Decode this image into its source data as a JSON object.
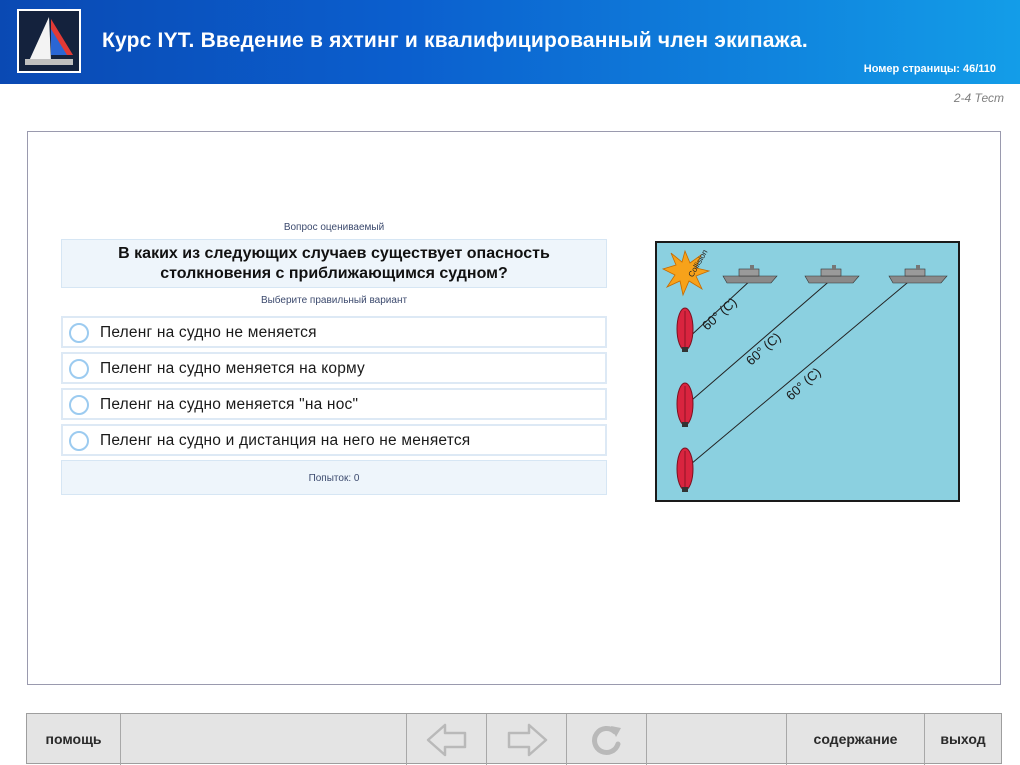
{
  "header": {
    "title": "Курс IYT. Введение в яхтинг и квалифицированный член экипажа.",
    "page_label": "Номер страницы: 46/110"
  },
  "section_label": "2-4 Тест",
  "question": {
    "graded_label": "Вопрос оцениваемый",
    "text_line1": "В каких из следующих случаев существует опасность",
    "text_line2": "столкновения с приближающимся судном?",
    "instruction": "Выберите правильный вариант",
    "options": [
      "Пеленг на судно не меняется",
      "Пеленг на судно меняется на корму",
      "Пеленг на судно меняется \"на нос\"",
      "Пеленг на судно и дистанция на него не меняется"
    ],
    "attempts": "Попыток: 0"
  },
  "diagram": {
    "collision_label": "Collision",
    "bearing_label": "60° (C)"
  },
  "navbar": {
    "help": "помощь",
    "contents": "содержание",
    "exit": "выход"
  },
  "colors": {
    "header_start": "#0a49b3",
    "header_end": "#139de8",
    "sea": "#8bd0e0",
    "boat": "#d9243f",
    "ship": "#8a8a8a"
  }
}
